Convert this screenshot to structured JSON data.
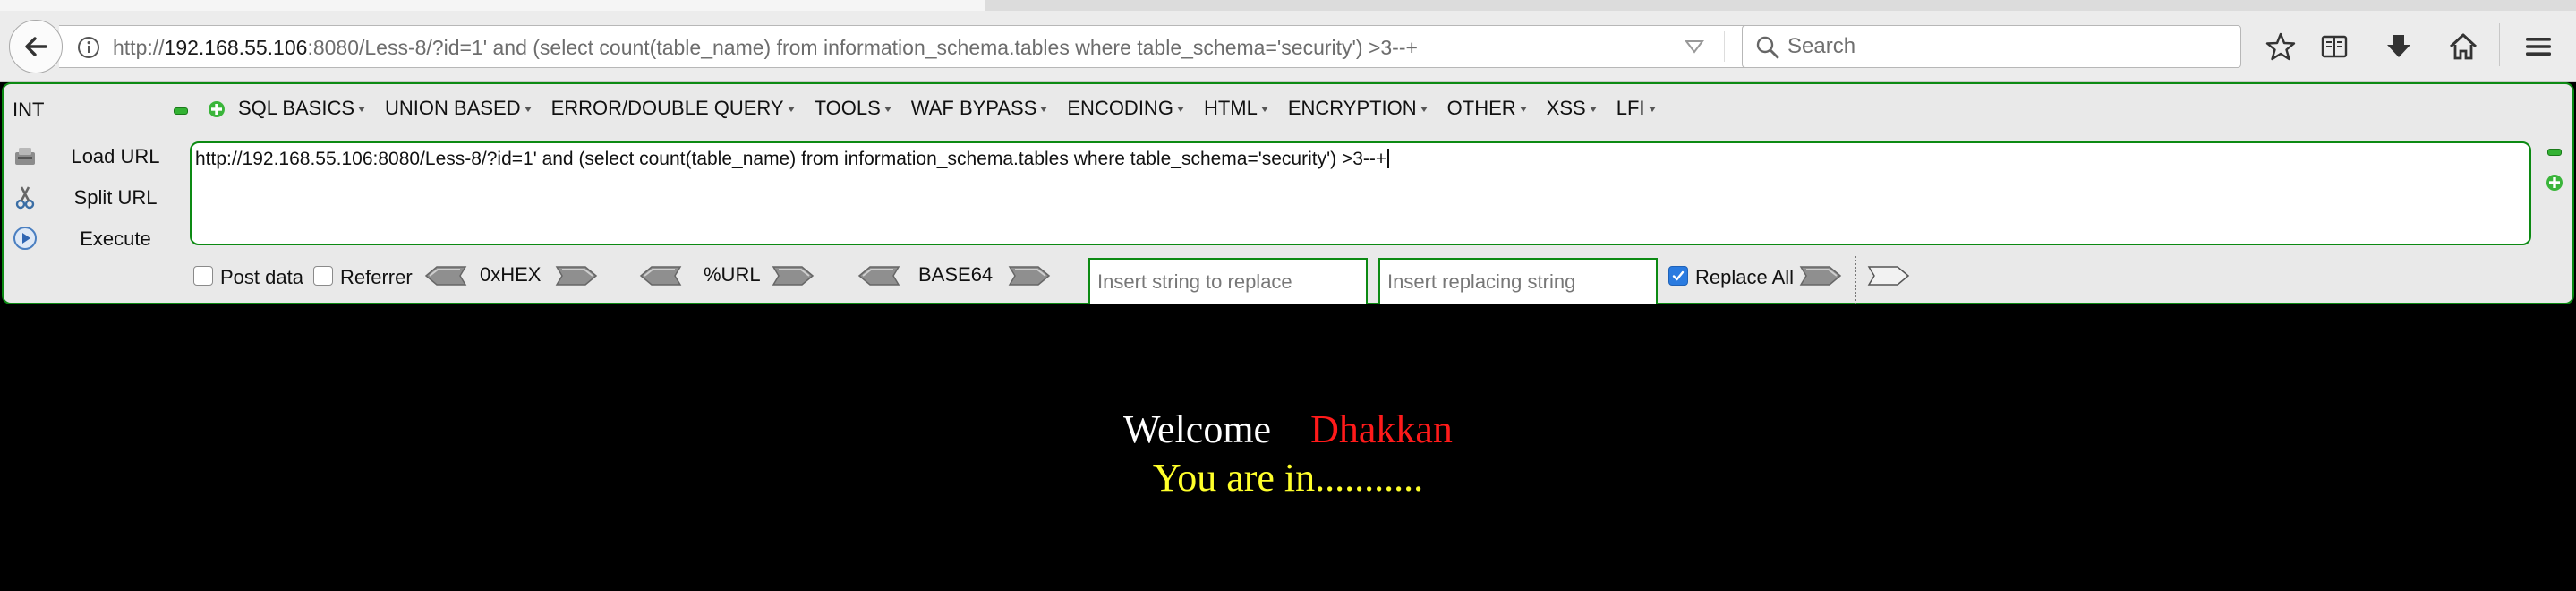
{
  "browser": {
    "url_prefix": "http://",
    "url_host": "192.168.55.106",
    "url_rest": ":8080/Less-8/?id=1' and (select count(table_name) from information_schema.tables where table_schema='security') >3--+",
    "search_placeholder": "Search"
  },
  "hackbar": {
    "int_label": "INT",
    "menu": [
      "SQL BASICS",
      "UNION BASED",
      "ERROR/DOUBLE QUERY",
      "TOOLS",
      "WAF BYPASS",
      "ENCODING",
      "HTML",
      "ENCRYPTION",
      "OTHER",
      "XSS",
      "LFI"
    ],
    "load_url": "Load URL",
    "split_url": "Split URL",
    "execute": "Execute",
    "url_value": "http://192.168.55.106:8080/Less-8/?id=1' and (select count(table_name) from information_schema.tables where table_schema='security') >3--+",
    "post_data": "Post data",
    "referrer": "Referrer",
    "hex_label": "0xHEX",
    "url_enc_label": "%URL",
    "base64_label": "BASE64",
    "replace_placeholder": "Insert string to replace",
    "replacing_placeholder": "Insert replacing string",
    "replace_all": "Replace All",
    "post_data_checked": false,
    "referrer_checked": false,
    "replace_all_checked": true
  },
  "page": {
    "welcome": "Welcome",
    "name": "Dhakkan",
    "status": "You are in..........."
  },
  "colors": {
    "hackbar_border": "#0c8a13",
    "welcome": "#ffffff",
    "name": "#ff1a1a",
    "status": "#ffff2a"
  }
}
